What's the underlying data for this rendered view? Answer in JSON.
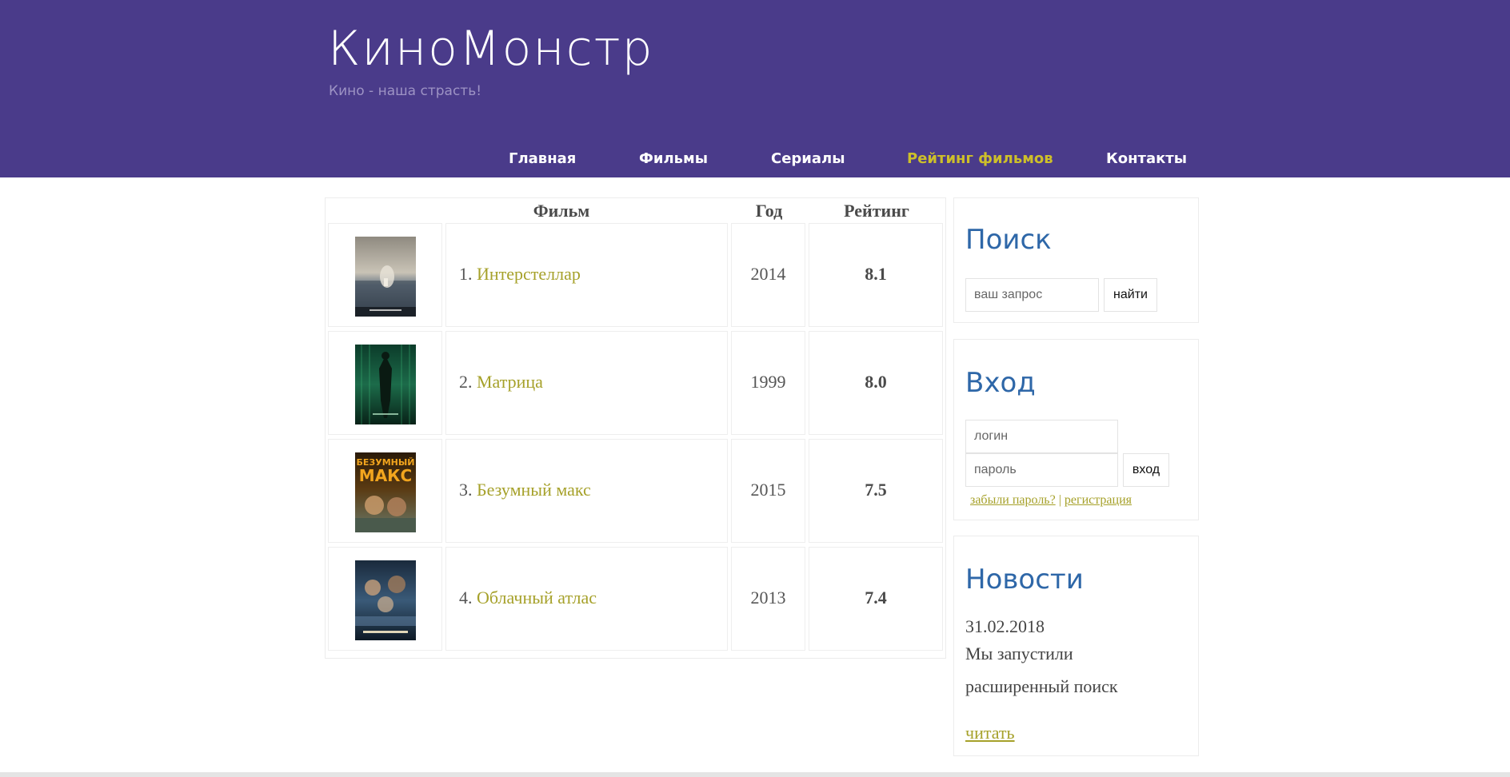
{
  "header": {
    "title": "КиноМонстр",
    "subtitle": "Кино - наша страсть!",
    "background": "#4a3b8a"
  },
  "nav": {
    "items": [
      {
        "label": "Главная"
      },
      {
        "label": "Фильмы"
      },
      {
        "label": "Сериалы"
      },
      {
        "label": "Рейтинг фильмов",
        "active": true
      },
      {
        "label": "Контакты"
      }
    ],
    "active_color": "#cdbf2a"
  },
  "movies": {
    "headers": {
      "film": "Фильм",
      "year": "Год",
      "rating": "Рейтинг"
    },
    "rows": [
      {
        "num": "1.",
        "title": "Интерстеллар",
        "year": "2014",
        "rating": "8.1",
        "poster": "interstellar-poster"
      },
      {
        "num": "2.",
        "title": "Матрица",
        "year": "1999",
        "rating": "8.0",
        "poster": "matrix-poster"
      },
      {
        "num": "3.",
        "title": "Безумный макс",
        "year": "2015",
        "rating": "7.5",
        "poster": "mad-max-poster"
      },
      {
        "num": "4.",
        "title": "Облачный атлас",
        "year": "2013",
        "rating": "7.4",
        "poster": "cloud-atlas-poster"
      }
    ],
    "poster_captions": {
      "mad_max_line1": "БЕЗУМНЫЙ",
      "mad_max_line2": "МАКС"
    }
  },
  "search": {
    "title": "Поиск",
    "placeholder": "ваш запрос",
    "button": "найти"
  },
  "login": {
    "title": "Вход",
    "login_placeholder": "логин",
    "password_placeholder": "пароль",
    "button": "вход",
    "forgot": "забыли пароль?",
    "separator": "|",
    "register": "регистрация"
  },
  "news": {
    "title": "Новости",
    "date": "31.02.2018",
    "text_line1": "Мы запустили",
    "text_line2": "расширенный поиск",
    "read_more": "читать"
  },
  "colors": {
    "accent_link": "#a6a12a",
    "widget_title": "#2e67a8"
  }
}
